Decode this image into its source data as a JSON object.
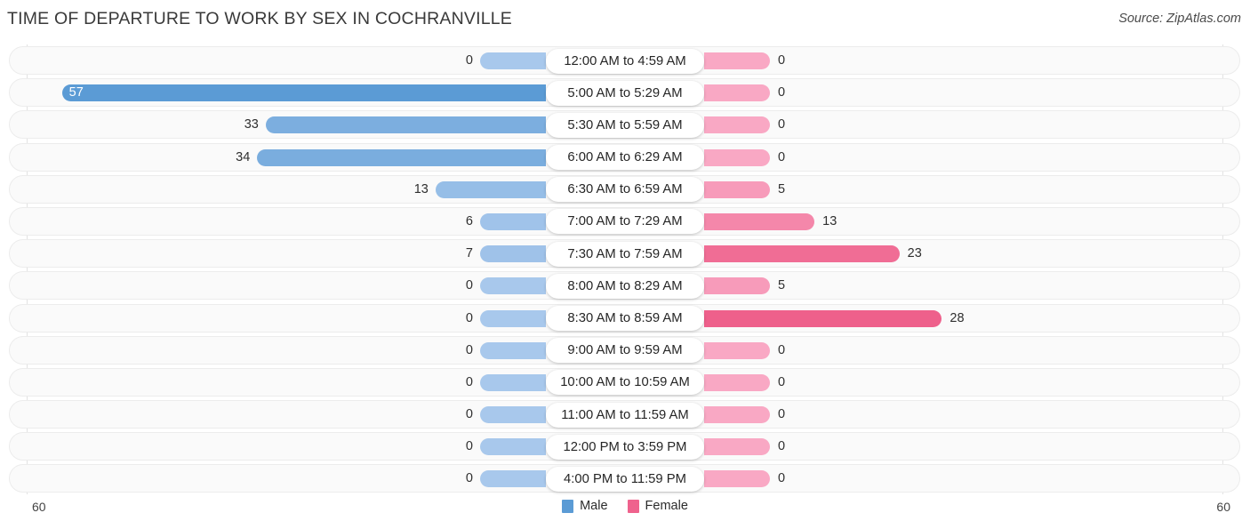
{
  "header": {
    "title": "TIME OF DEPARTURE TO WORK BY SEX IN COCHRANVILLE",
    "source": "Source: ZipAtlas.com"
  },
  "axis": {
    "left_max": "60",
    "right_max": "60"
  },
  "legend": {
    "items": [
      {
        "label": "Male",
        "color": "#5b9bd5"
      },
      {
        "label": "Female",
        "color": "#ef628d"
      }
    ]
  },
  "colors": {
    "male_min": "#a8c8ec",
    "male_max": "#5b9bd5",
    "female_min": "#f9a8c4",
    "female_max": "#ee5f8a",
    "track_bg": "#fafafa",
    "track_border": "#ececec",
    "axis_line": "#e2e2e2"
  },
  "chart_data": {
    "type": "bar",
    "title": "TIME OF DEPARTURE TO WORK BY SEX IN COCHRANVILLE",
    "xlabel": "",
    "ylabel": "",
    "orientation": "horizontal-diverging",
    "xlim": [
      60,
      60
    ],
    "grid": false,
    "legend_position": "bottom-center",
    "categories": [
      "12:00 AM to 4:59 AM",
      "5:00 AM to 5:29 AM",
      "5:30 AM to 5:59 AM",
      "6:00 AM to 6:29 AM",
      "6:30 AM to 6:59 AM",
      "7:00 AM to 7:29 AM",
      "7:30 AM to 7:59 AM",
      "8:00 AM to 8:29 AM",
      "8:30 AM to 8:59 AM",
      "9:00 AM to 9:59 AM",
      "10:00 AM to 10:59 AM",
      "11:00 AM to 11:59 AM",
      "12:00 PM to 3:59 PM",
      "4:00 PM to 11:59 PM"
    ],
    "series": [
      {
        "name": "Male",
        "side": "left",
        "values": [
          0,
          57,
          33,
          34,
          13,
          6,
          7,
          0,
          0,
          0,
          0,
          0,
          0,
          0
        ]
      },
      {
        "name": "Female",
        "side": "right",
        "values": [
          0,
          0,
          0,
          0,
          5,
          13,
          23,
          5,
          28,
          0,
          0,
          0,
          0,
          0
        ]
      }
    ],
    "value_labels": {
      "male": [
        "0",
        "57",
        "33",
        "34",
        "13",
        "6",
        "7",
        "0",
        "0",
        "0",
        "0",
        "0",
        "0",
        "0"
      ],
      "female": [
        "0",
        "0",
        "0",
        "0",
        "5",
        "13",
        "23",
        "5",
        "28",
        "0",
        "0",
        "0",
        "0",
        "0"
      ]
    }
  }
}
